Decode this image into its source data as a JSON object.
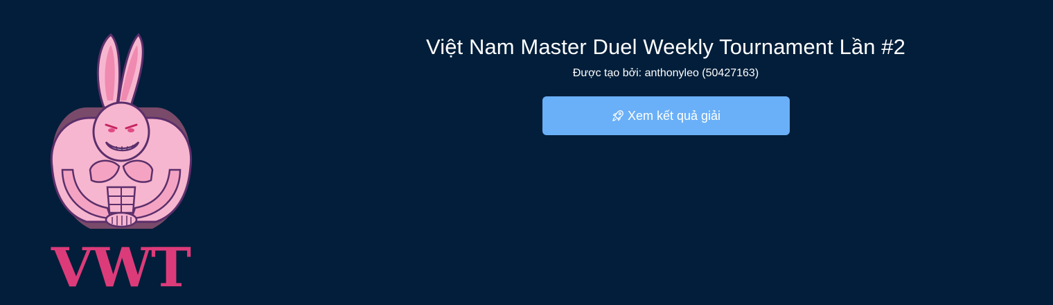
{
  "logo": {
    "text": "VWT",
    "icon": "pink-muscular-rabbit-logo",
    "colors": {
      "pink": "#f7b6cf",
      "accent": "#dc3b7a",
      "outline": "#5b2f6b"
    }
  },
  "tournament": {
    "title": "Việt Nam Master Duel Weekly Tournament Lần #2",
    "created_by": "Được tạo bởi: anthonyleo (50427163)"
  },
  "actions": {
    "view_results_label": "Xem kết quả giải",
    "view_results_icon": "rocket-icon"
  },
  "colors": {
    "background": "#021e3a",
    "button": "#6ab0f8",
    "text": "#ffffff"
  }
}
